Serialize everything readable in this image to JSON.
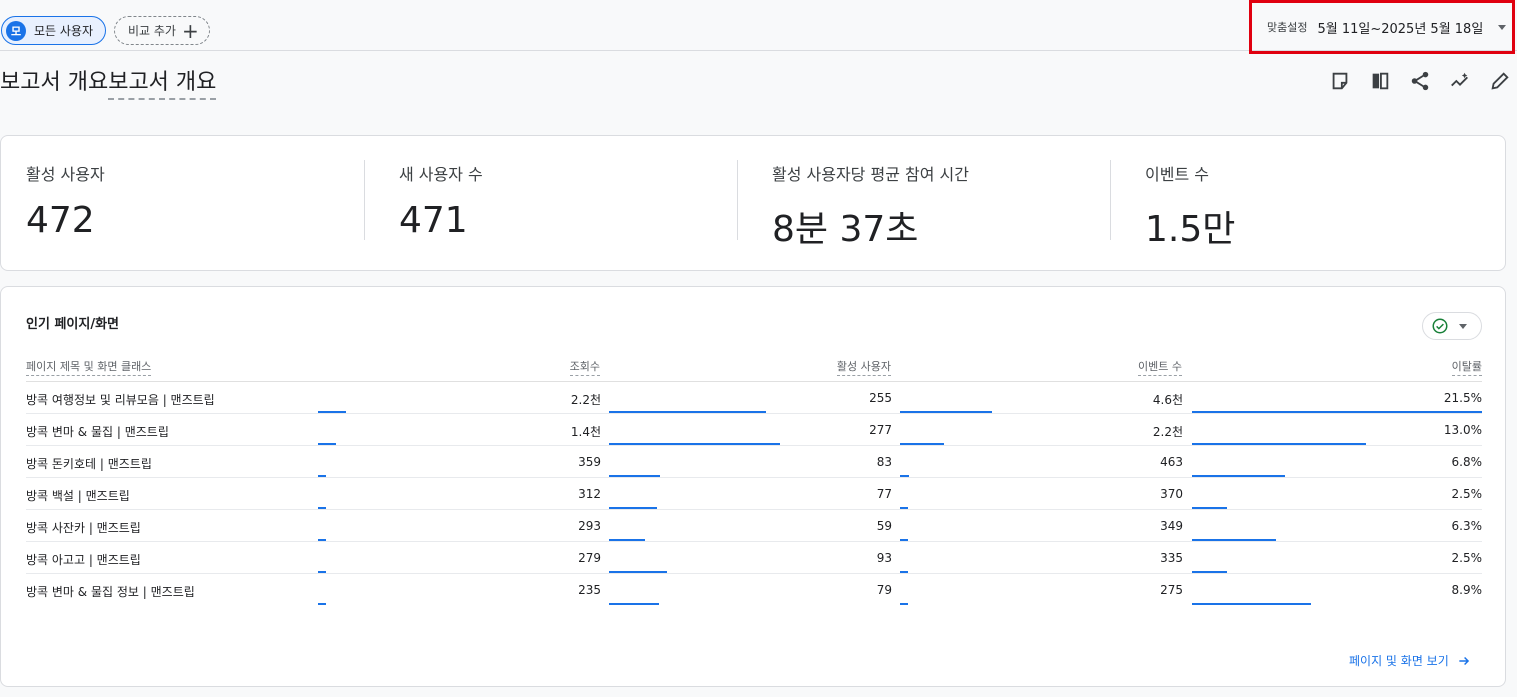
{
  "topbar": {
    "segment_avatar": "모",
    "segment_label": "모든 사용자",
    "add_comparison_label": "비교 추가",
    "date_custom_label": "맞춤설정",
    "date_range": "5월 11일~2025년 5월 18일"
  },
  "header": {
    "title_a": "보고서 개요",
    "title_b": "보고서 개요",
    "tools": [
      "note-icon",
      "compare-icon",
      "share-icon",
      "insights-icon",
      "edit-icon"
    ]
  },
  "kpis": [
    {
      "label": "활성 사용자",
      "value": "472"
    },
    {
      "label": "새 사용자 수",
      "value": "471"
    },
    {
      "label": "활성 사용자당 평균 참여 시간",
      "value": "8분 37초"
    },
    {
      "label": "이벤트 수",
      "value": "1.5만"
    }
  ],
  "table": {
    "title": "인기 페이지/화면",
    "columns": [
      "페이지 제목 및 화면 클래스",
      "조회수",
      "활성 사용자",
      "이벤트 수",
      "이탈률"
    ],
    "rows": [
      {
        "page": "방콕 여행정보 및 리뷰모음 | 맨즈트립",
        "views": "2.2천",
        "views_pct": 0.45,
        "users": "255",
        "users_pct": 0.92,
        "events": "4.6천",
        "events_pct": 1.0,
        "bounce": "21.5%",
        "bounce_pct": 1.0
      },
      {
        "page": "방콕 변마 & 물집 | 맨즈트립",
        "views": "1.4천",
        "views_pct": 0.29,
        "users": "277",
        "users_pct": 1.0,
        "events": "2.2천",
        "events_pct": 0.48,
        "bounce": "13.0%",
        "bounce_pct": 0.6
      },
      {
        "page": "방콕 돈키호테 | 맨즈트립",
        "views": "359",
        "views_pct": 0.07,
        "users": "83",
        "users_pct": 0.3,
        "events": "463",
        "events_pct": 0.1,
        "bounce": "6.8%",
        "bounce_pct": 0.32
      },
      {
        "page": "방콕 백설 | 맨즈트립",
        "views": "312",
        "views_pct": 0.06,
        "users": "77",
        "users_pct": 0.28,
        "events": "370",
        "events_pct": 0.08,
        "bounce": "2.5%",
        "bounce_pct": 0.12
      },
      {
        "page": "방콕 사잔카 | 맨즈트립",
        "views": "293",
        "views_pct": 0.06,
        "users": "59",
        "users_pct": 0.21,
        "events": "349",
        "events_pct": 0.08,
        "bounce": "6.3%",
        "bounce_pct": 0.29
      },
      {
        "page": "방콕 아고고 | 맨즈트립",
        "views": "279",
        "views_pct": 0.06,
        "users": "93",
        "users_pct": 0.34,
        "events": "335",
        "events_pct": 0.07,
        "bounce": "2.5%",
        "bounce_pct": 0.12
      },
      {
        "page": "방콕 변마 & 물집 정보 | 맨즈트립",
        "views": "235",
        "views_pct": 0.05,
        "users": "79",
        "users_pct": 0.29,
        "events": "275",
        "events_pct": 0.06,
        "bounce": "8.9%",
        "bounce_pct": 0.41
      }
    ],
    "view_link": "페이지 및 화면 보기"
  },
  "colors": {
    "accent": "#1a73e8",
    "highlight_border": "#e0000f",
    "check_green": "#188038"
  }
}
